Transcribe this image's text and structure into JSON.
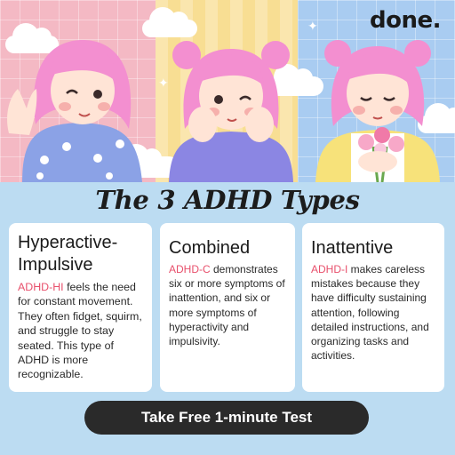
{
  "brand": {
    "logo_text": "done."
  },
  "hero": {
    "panel_colors": [
      "#f4b9c4",
      "#f8de93",
      "#a9ccf1"
    ],
    "hair_color": "#f38fd0",
    "illustration": [
      "character-waving",
      "character-cheeks-in-hands",
      "character-holding-flowers"
    ]
  },
  "title": "The 3 ADHD Types",
  "cards": [
    {
      "heading": "Hyperactive-Impulsive",
      "tag": "ADHD-HI",
      "body": " feels the need for constant movement. They often fidget, squirm, and struggle to stay seated. This type of ADHD is more recognizable."
    },
    {
      "heading": "Combined",
      "tag": "ADHD-C",
      "body": " demonstrates six or more symptoms of inattention, and six or more symptoms of hyperactivity and impulsivity."
    },
    {
      "heading": "Inattentive",
      "tag": "ADHD-I",
      "body": " makes careless mistakes because they have difficulty sustaining attention, following detailed instructions, and organizing tasks and activities."
    }
  ],
  "cta": {
    "label": "Take Free 1-minute Test"
  },
  "colors": {
    "accent": "#e8506c",
    "cta_bg": "#2a2a2a",
    "page_bg": "#bcdcf2"
  }
}
